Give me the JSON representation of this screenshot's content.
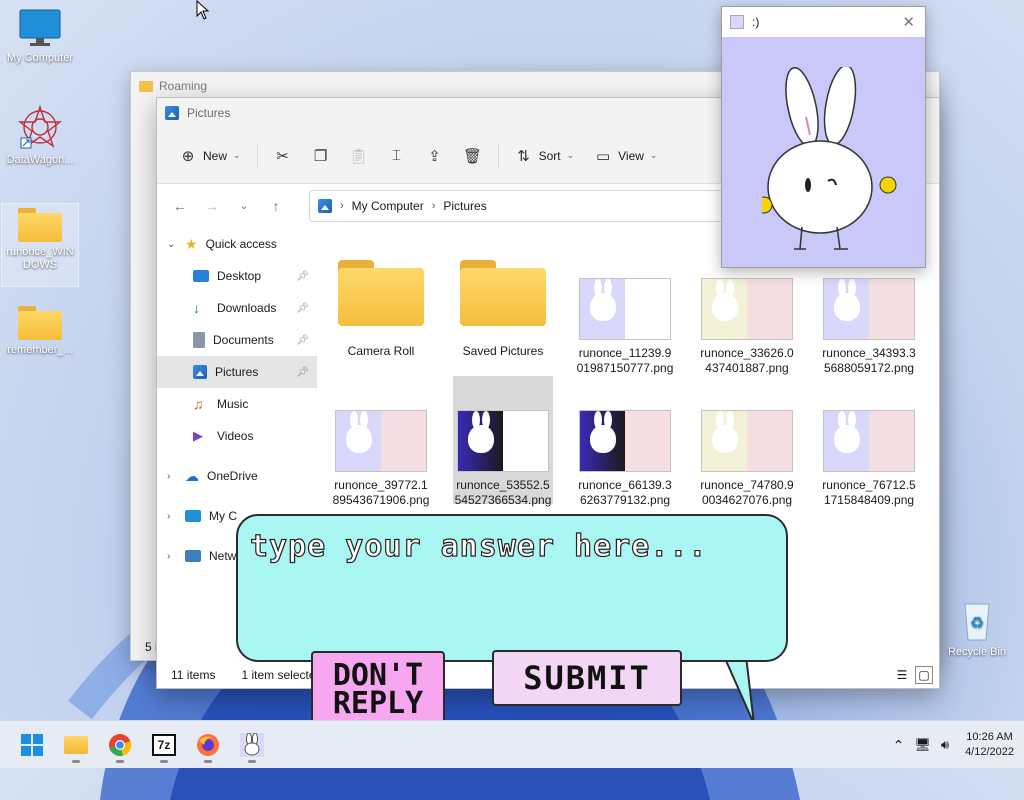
{
  "desktop": {
    "icons": [
      {
        "label": "My Computer"
      },
      {
        "label": "DataWagon..."
      },
      {
        "label": "runonce_WIN\nDOWS"
      },
      {
        "label": "remember_..."
      }
    ],
    "recycle_bin": "Recycle Bin"
  },
  "back_window": {
    "title": "Roaming",
    "status_prefix": "5 i"
  },
  "explorer": {
    "title": "Pictures",
    "toolbar": {
      "new_label": "New",
      "sort_label": "Sort",
      "view_label": "View"
    },
    "address": {
      "root": "My Computer",
      "current": "Pictures"
    },
    "sidebar": {
      "quick_access": "Quick access",
      "items": [
        {
          "label": "Desktop",
          "pinned": true
        },
        {
          "label": "Downloads",
          "pinned": true
        },
        {
          "label": "Documents",
          "pinned": true
        },
        {
          "label": "Pictures",
          "pinned": true
        },
        {
          "label": "Music",
          "pinned": false
        },
        {
          "label": "Videos",
          "pinned": false
        }
      ],
      "onedrive": "OneDrive",
      "mycomputer": "My C",
      "network": "Netw"
    },
    "files": [
      {
        "name": "Camera Roll",
        "type": "folder"
      },
      {
        "name": "Saved Pictures",
        "type": "folder"
      },
      {
        "name": "runonce_11239.9\n01987150777.png",
        "type": "image",
        "bg": "#d9d7fb"
      },
      {
        "name": "runonce_33626.0\n437401887.png",
        "type": "image",
        "bg": "#f3f2d7"
      },
      {
        "name": "runonce_34393.3\n5688059172.png",
        "type": "image",
        "bg": "#d9d7fb"
      },
      {
        "name": "runonce_39772.1\n89543671906.png",
        "type": "image",
        "bg": "#d9d7fb"
      },
      {
        "name": "runonce_53552.5\n54527366534.png",
        "type": "image",
        "bg": "#3a2ab8",
        "selected": true
      },
      {
        "name": "runonce_66139.3\n6263779132.png",
        "type": "image",
        "bg": "#3a2ab8"
      },
      {
        "name": "runonce_74780.9\n0034627076.png",
        "type": "image",
        "bg": "#f3f2d7"
      },
      {
        "name": "runonce_76712.5\n1715848409.png",
        "type": "image",
        "bg": "#d9d7fb"
      }
    ],
    "status": {
      "count": "11 items",
      "selection": "1 item selecte"
    }
  },
  "popup": {
    "title": ":)",
    "bg": "#c9c8f9"
  },
  "dialog": {
    "placeholder": "type your answer here...",
    "dont_reply": "DON'T REPLY",
    "submit": "SUBMIT",
    "bubble_color": "#a9f6f3",
    "dont_color": "#f6a7f0",
    "submit_color": "#f3d6f6"
  },
  "taskbar": {
    "apps": [
      "start-icon",
      "file-explorer-icon",
      "chrome-icon",
      "7zip-icon",
      "firefox-icon",
      "runonce-bunny-icon"
    ],
    "time": "10:26 AM",
    "date": "4/12/2022"
  }
}
